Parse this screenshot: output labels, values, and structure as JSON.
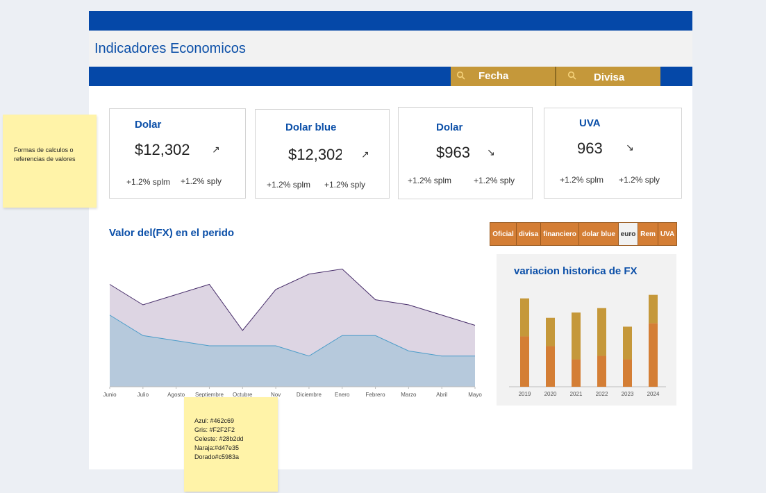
{
  "header": {
    "title": "Indicadores Economicos"
  },
  "filters": [
    {
      "label": "Fecha",
      "icon": "search-icon"
    },
    {
      "label": "Divisa",
      "icon": "search-icon"
    }
  ],
  "cards": [
    {
      "title": "Dolar",
      "value": "$12,302",
      "trend": "↗",
      "trend_icon": "trend-up-icon",
      "splm": "+1.2% splm",
      "sply": "+1.2% sply"
    },
    {
      "title": "Dolar blue",
      "value": "$12,302",
      "trend": "↗",
      "trend_icon": "trend-up-icon",
      "splm": "+1.2% splm",
      "sply": "+1.2% sply"
    },
    {
      "title": "Dolar",
      "value": "$963",
      "trend": "↘",
      "trend_icon": "trend-down-icon",
      "splm": "+1.2% splm",
      "sply": "+1.2% sply"
    },
    {
      "title": "UVA",
      "value": "963",
      "trend": "↘",
      "trend_icon": "trend-down-icon",
      "splm": "+1.2% splm",
      "sply": "+1.2% sply"
    }
  ],
  "area_section": {
    "title": "Valor del(FX) en el perido"
  },
  "tabs": [
    {
      "label": "Oficial",
      "selected": false
    },
    {
      "label": "divisa",
      "selected": false
    },
    {
      "label": "financiero",
      "selected": false
    },
    {
      "label": "dolar blue",
      "selected": false
    },
    {
      "label": "euro",
      "selected": true
    },
    {
      "label": "Rem",
      "selected": false
    },
    {
      "label": "UVA",
      "selected": false
    }
  ],
  "bar_section": {
    "title": "variacion historica de FX"
  },
  "notes": {
    "left": "Formas de calculos o referencias de valores",
    "colors": [
      "Azul: #462c69",
      "Gris: #F2F2F2",
      "Celeste: #28b2dd",
      "Naraja:#d47e35",
      "Dorado#c5983a"
    ]
  },
  "colors": {
    "azul": "#462c69",
    "gris": "#F2F2F2",
    "celeste": "#28b2dd",
    "naranja": "#d47e35",
    "dorado": "#c5983a",
    "header_blue": "#0548a8"
  },
  "chart_data": [
    {
      "type": "area",
      "x": [
        "Junio",
        "Julio",
        "Agosto",
        "Septiembre",
        "Octubre",
        "Nov",
        "Diciembre",
        "Enero",
        "Febrero",
        "Marzo",
        "Abril",
        "Mayo"
      ],
      "series": [
        {
          "values": [
            100,
            80,
            90,
            100,
            55,
            95,
            110,
            115,
            85,
            80,
            70,
            60
          ],
          "color": "#462c69"
        },
        {
          "values": [
            70,
            50,
            45,
            40,
            40,
            40,
            30,
            50,
            50,
            35,
            30,
            30
          ],
          "color": "#28b2dd"
        }
      ],
      "ylim": [
        0,
        120
      ],
      "grid": false
    },
    {
      "type": "bar",
      "categories": [
        "2019",
        "2020",
        "2021",
        "2022",
        "2023",
        "2024"
      ],
      "series": [
        {
          "values": [
            57,
            46,
            31,
            35,
            31,
            72
          ],
          "color": "#d47e35"
        },
        {
          "values": [
            43,
            32,
            53,
            54,
            37,
            32
          ],
          "color": "#c5983a"
        }
      ],
      "stacked": true,
      "ylim": [
        0,
        110
      ]
    }
  ]
}
